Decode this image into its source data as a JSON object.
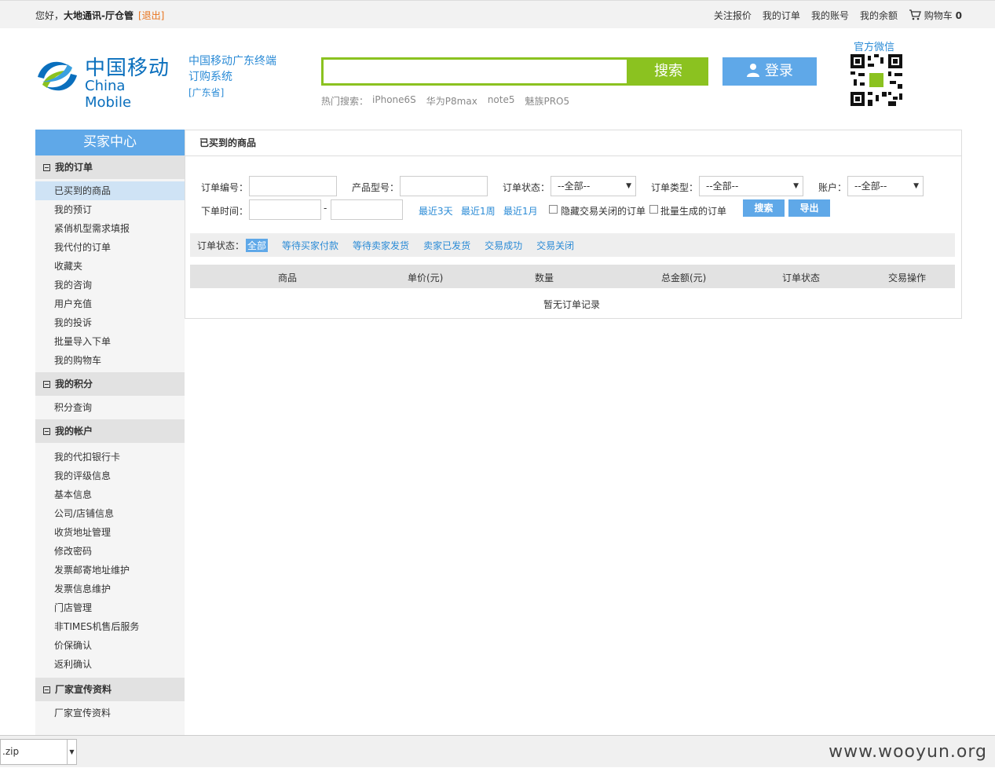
{
  "topbar": {
    "greeting": "您好，",
    "user": "大地通讯-厅仓管",
    "logout": "[退出]",
    "links": [
      "关注报价",
      "我的订单",
      "我的账号",
      "我的余额"
    ],
    "cart_label": "购物车",
    "cart_count": "0"
  },
  "header": {
    "logo_cn": "中国移动",
    "logo_en": "China Mobile",
    "slogan_line1": "中国移动广东终端",
    "slogan_line2": "订购系统",
    "province": "[广东省]",
    "search_placeholder": "",
    "search_button": "搜索",
    "login_button": "登录",
    "hot_label": "热门搜索：",
    "hot_terms": [
      "iPhone6S",
      "华为P8max",
      "note5",
      "魅族PRO5"
    ],
    "wechat_label": "官方微信"
  },
  "sidebar": {
    "title": "买家中心",
    "sections": [
      {
        "title": "我的订单",
        "items": [
          "已买到的商品",
          "我的预订",
          "紧俏机型需求填报",
          "我代付的订单",
          "收藏夹",
          "我的咨询",
          "用户充值",
          "我的投诉",
          "批量导入下单",
          "我的购物车"
        ]
      },
      {
        "title": "我的积分",
        "items": [
          "积分查询"
        ]
      },
      {
        "title": "我的帐户",
        "items": [
          "我的代扣银行卡",
          "我的评级信息",
          "基本信息",
          "公司/店铺信息",
          "收货地址管理",
          "修改密码",
          "发票邮寄地址维护",
          "发票信息维护",
          "门店管理",
          "非TIMES机售后服务",
          "价保确认",
          "返利确认"
        ]
      },
      {
        "title": "厂家宣传资料",
        "items": [
          "厂家宣传资料"
        ]
      }
    ]
  },
  "main": {
    "heading": "已买到的商品",
    "filters": {
      "order_no": "订单编号：",
      "product_model": "产品型号：",
      "order_status": "订单状态：",
      "order_type": "订单类型：",
      "account": "账户：",
      "all_option": "--全部--",
      "order_time": "下单时间：",
      "dash": "-",
      "recent_3d": "最近3天",
      "recent_1w": "最近1周",
      "recent_1m": "最近1月",
      "hide_closed": "隐藏交易关闭的订单",
      "batch_generated": "批量生成的订单",
      "search": "搜索",
      "export": "导出"
    },
    "status_tabs": {
      "label": "订单状态：",
      "tabs": [
        "全部",
        "等待买家付款",
        "等待卖家发货",
        "卖家已发货",
        "交易成功",
        "交易关闭"
      ]
    },
    "table_headers": [
      "商品",
      "单价(元)",
      "数量",
      "总金额(元)",
      "订单状态",
      "交易操作"
    ],
    "empty_text": "暂无订单记录"
  },
  "bottombar": {
    "download_file": ".zip",
    "watermark": "www.wooyun.org"
  }
}
